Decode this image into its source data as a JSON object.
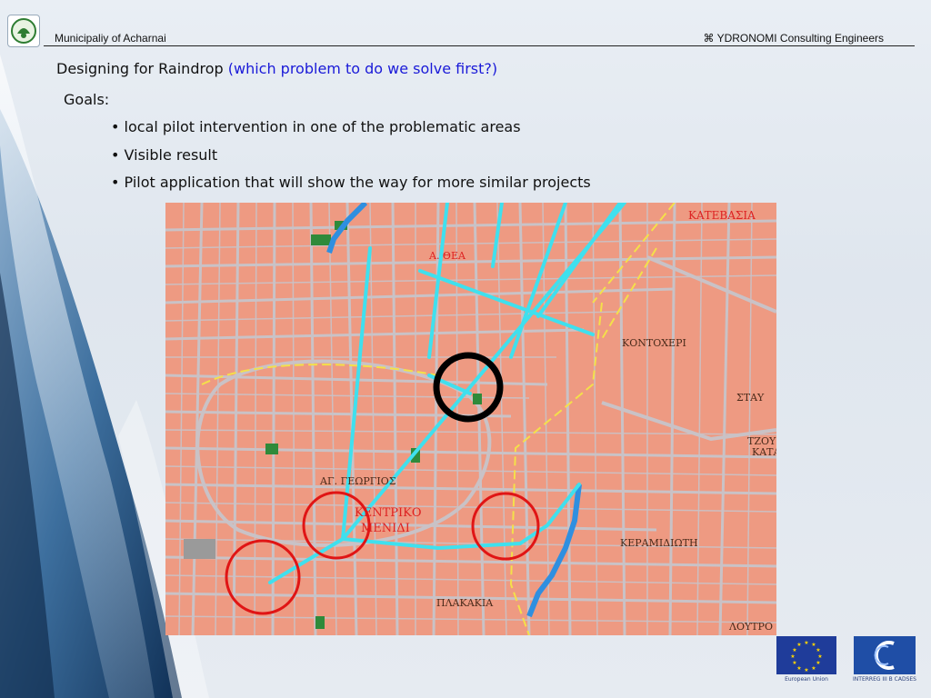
{
  "header": {
    "left_text": "Municipaliy of Acharnai",
    "right_text": "⌘ YDRONOMI Consulting Engineers"
  },
  "slide": {
    "title_main": "Designing for Raindrop ",
    "title_question": "(which problem to do we solve first?)",
    "goals_label": "Goals:",
    "bullets": [
      "local pilot intervention in one of the problematic areas",
      "Visible result",
      "Pilot application that will show the way for more similar projects"
    ]
  },
  "map": {
    "place_labels": {
      "kateyasia": "ΚΑΤΕΒΑΣΙΑ",
      "athea": "Α. ΘΕΑ",
      "kontoxeri": "ΚΟΝΤΟΧΕΡΙ",
      "ag_georgios": "ΑΓ. ΓΕΩΡΓΙΟΣ",
      "kentriko": "ΚΕΝΤΡΙΚΟ",
      "menidi": "ΜΕΝΙΔΙ",
      "keramidioti": "ΚΕΡΑΜΙΔΙΩΤΗ",
      "plakakia": "ΠΛΑΚΑΚΙΑ",
      "loytro": "ΛΟΥΤΡΟ",
      "stay": "ΣΤΑΥ",
      "tzoy": "ΤΖΟΥ",
      "kata": "ΚΑΤΑ"
    },
    "colors": {
      "land": "#ee9a82",
      "roads": "#c9c2c6",
      "drainage_lines": "#3fe0ee",
      "river": "#2f8fe0",
      "selected_circle": "#000000",
      "candidate_circles": "#e01515",
      "parks": "#2f8a3a"
    }
  },
  "footer": {
    "eu_label": "European Union",
    "interreg_label": "INTERREG III B CADSES"
  }
}
